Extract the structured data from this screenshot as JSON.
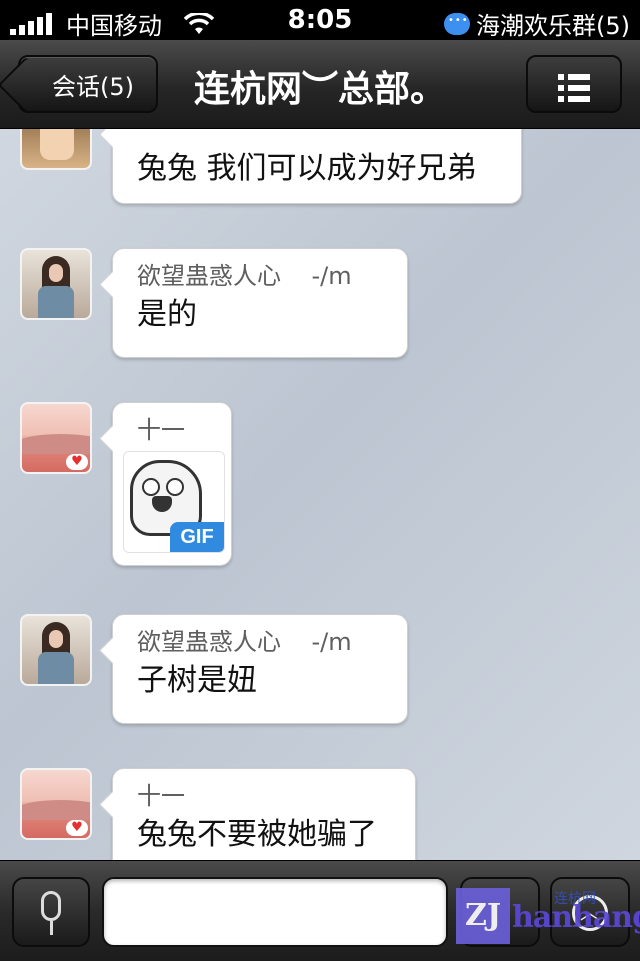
{
  "status_bar": {
    "carrier": "中国移动",
    "time": "8:05",
    "notification": "海潮欢乐群(5)"
  },
  "nav": {
    "back_label": "会话(5)",
    "title": "连杭网︶总部。"
  },
  "messages": [
    {
      "sender": "",
      "text": "兔兔 我们可以成为好兄弟",
      "avatar": "boy-avatar"
    },
    {
      "sender": "欲望蛊惑人心    -/m",
      "text": "是的",
      "avatar": "girl-avatar"
    },
    {
      "sender": "十一",
      "text": "",
      "sticker_label": "GIF",
      "avatar": "landscape-avatar"
    },
    {
      "sender": "欲望蛊惑人心    -/m",
      "text": "子树是妞",
      "avatar": "girl-avatar"
    },
    {
      "sender": "十一",
      "text": "兔兔不要被她骗了",
      "avatar": "landscape-avatar"
    }
  ],
  "toolbar": {
    "input_value": ""
  },
  "watermark": {
    "logo": "ZJ",
    "text": "hanhang",
    "small": "连杭网"
  }
}
